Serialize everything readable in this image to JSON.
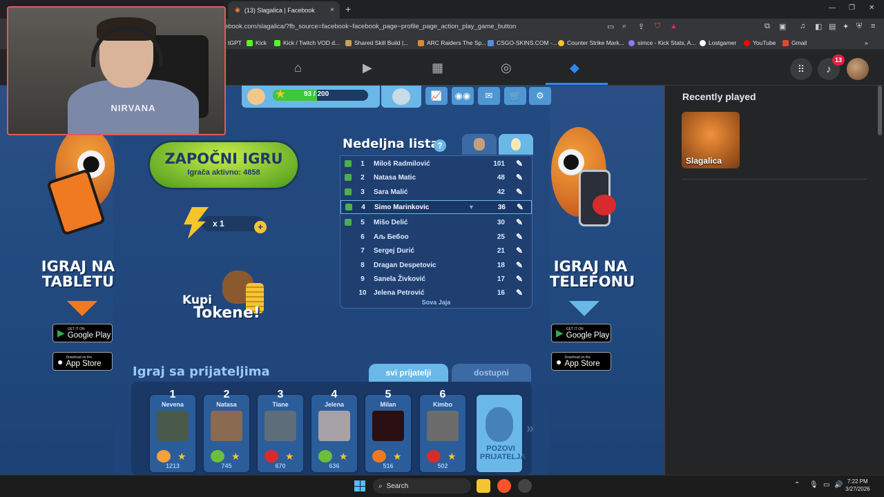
{
  "browser": {
    "tab_title": "(13) Slagalica | Facebook",
    "tab_close": "×",
    "new_tab": "+",
    "url": "ebook.com/slagalica/?fb_source=facebook~facebook_page~profile_page_action_play_game_button",
    "window_controls": [
      "—",
      "❐",
      "✕"
    ],
    "bookmarks": [
      {
        "label": "tGPT",
        "color": "#9aa0a6"
      },
      {
        "label": "Kick",
        "color": "#53fc18"
      },
      {
        "label": "Kick / Twitch VOD d...",
        "color": "#53fc18"
      },
      {
        "label": "Shared Skill Build |...",
        "color": "#c6a35a"
      },
      {
        "label": "ARC Raiders The Sp...",
        "color": "#d58a35"
      },
      {
        "label": "CSGO-SKINS.COM -...",
        "color": "#5b8bd6"
      },
      {
        "label": "Counter Strike Mark...",
        "color": "#f2c531"
      },
      {
        "label": "simce - Kick Stats, A...",
        "color": "#8a7ef0"
      },
      {
        "label": "Lostgamer",
        "color": "#ffffff"
      },
      {
        "label": "YouTube",
        "color": "#ff0000"
      },
      {
        "label": "Gmail",
        "color": "#ea4335"
      }
    ],
    "bookmarks_more": "»"
  },
  "facebook": {
    "notification_count": "13",
    "accent": "#2d88ff"
  },
  "game": {
    "xp": {
      "current": "93",
      "separator": "/",
      "max": "200",
      "fraction": 0.465
    },
    "start_button": {
      "title": "ZAPOČNI IGRU",
      "subtitle": "Igrača aktivno: 4858"
    },
    "tokens": {
      "count": "x 1",
      "plus": "+"
    },
    "buy_tokens": {
      "line1": "Kupi",
      "line2": "Tokene!"
    },
    "leaderboard": {
      "title": "Nedeljna lista",
      "help": "?",
      "footer": "Sova Jaja",
      "rows": [
        {
          "rank": "1",
          "name": "Miloš Radmilović",
          "score": "101"
        },
        {
          "rank": "2",
          "name": "Natasa Matic",
          "score": "48"
        },
        {
          "rank": "3",
          "name": "Sara Malić",
          "score": "42"
        },
        {
          "rank": "4",
          "name": "Simo Marinkovic",
          "score": "36"
        },
        {
          "rank": "5",
          "name": "Mišo Delić",
          "score": "30"
        },
        {
          "rank": "6",
          "name": "Аљ Бебоо",
          "score": "25"
        },
        {
          "rank": "7",
          "name": "Sergej Durić",
          "score": "21"
        },
        {
          "rank": "8",
          "name": "Dragan Despetovic",
          "score": "18"
        },
        {
          "rank": "9",
          "name": "Sanela Živković",
          "score": "17"
        },
        {
          "rank": "10",
          "name": "Jelena Petrović",
          "score": "16"
        }
      ]
    },
    "promo_left": {
      "line1": "IGRAJ NA",
      "line2": "TABLETU"
    },
    "promo_right": {
      "line1": "IGRAJ NA",
      "line2": "TELEFONU"
    },
    "google_play": {
      "small": "GET IT ON",
      "large": "Google Play"
    },
    "app_store": {
      "small": "Download on the",
      "large": "App Store"
    },
    "friends": {
      "title": "Igraj sa prijateljima",
      "tab_all": "svi prijatelji",
      "tab_available": "dostupni",
      "invite": "POZOVI PRIJATELJA",
      "next": "»",
      "cards": [
        {
          "rank": "1",
          "name": "Nevena",
          "score": "1213"
        },
        {
          "rank": "2",
          "name": "Natasa",
          "score": "745"
        },
        {
          "rank": "3",
          "name": "Tiane",
          "score": "670"
        },
        {
          "rank": "4",
          "name": "Jelena",
          "score": "636"
        },
        {
          "rank": "5",
          "name": "Milan",
          "score": "516"
        },
        {
          "rank": "6",
          "name": "Kimbo",
          "score": "502"
        }
      ]
    }
  },
  "sidebar": {
    "recently_played_title": "Recently played",
    "recent_game": "Slagalica"
  },
  "webcam": {
    "shirt_text": "NIRVANA"
  },
  "taskbar": {
    "search": "Search",
    "time": "7:22 PM",
    "date": "3/27/2026"
  }
}
